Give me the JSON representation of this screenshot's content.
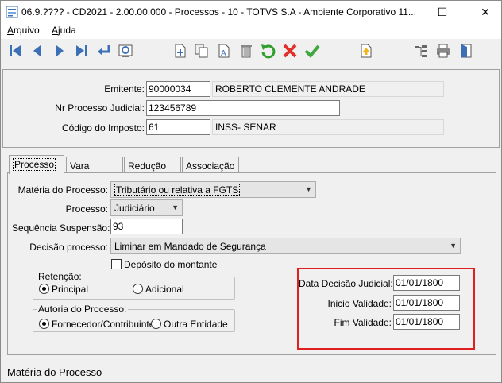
{
  "window": {
    "title": "06.9.???? - CD2021 - 2.00.00.000 - Processos - 10 - TOTVS S.A - Ambiente Corporativo 11...",
    "minimize": "—",
    "maximize": "☐",
    "close": "✕"
  },
  "menu": {
    "arquivo_first": "A",
    "arquivo_rest": "rquivo",
    "ajuda_first": "A",
    "ajuda_rest": "juda"
  },
  "toolbar": {
    "icons": [
      "first-record-icon",
      "previous-record-icon",
      "next-record-icon",
      "last-record-icon",
      "return-icon",
      "search-record-icon",
      "new-record-icon",
      "copy-record-icon",
      "edit-record-icon",
      "delete-record-icon",
      "undo-icon",
      "cancel-icon",
      "confirm-icon",
      "export-icon",
      "tree-icon",
      "print-icon",
      "exit-icon"
    ]
  },
  "header": {
    "emitente_label": "Emitente:",
    "emitente_code": "90000034",
    "emitente_name": "ROBERTO CLEMENTE ANDRADE",
    "processo_label": "Nr Processo Judicial:",
    "processo_value": "123456789",
    "imposto_label": "Código do Imposto:",
    "imposto_code": "61",
    "imposto_name": "INSS- SENAR"
  },
  "tabs": [
    "Processo",
    "Vara",
    "Redução",
    "Associação"
  ],
  "form": {
    "materia_label": "Matéria do Processo:",
    "materia_value": "Tributário ou relativa a FGTS",
    "processo_label": "Processo:",
    "processo_value": "Judiciário",
    "sequencia_label": "Sequência Suspensão:",
    "sequencia_value": "93",
    "decisao_label": "Decisão processo:",
    "decisao_value": "Liminar em Mandado de Segurança",
    "deposito_label": "Depósito do montante",
    "deposito_checked": false,
    "retencao_title": "Retenção:",
    "retencao_options": [
      "Principal",
      "Adicional"
    ],
    "retencao_selected": "Principal",
    "autoria_title": "Autoria do Processo:",
    "autoria_options": [
      "Fornecedor/Contribuinte",
      "Outra Entidade"
    ],
    "autoria_selected": "Fornecedor/Contribuinte",
    "data_decisao_label": "Data Decisão Judicial:",
    "data_decisao_value": "01/01/1800",
    "inicio_label": "Inicio Validade:",
    "inicio_value": "01/01/1800",
    "fim_label": "Fim Validade:",
    "fim_value": "01/01/1800",
    "highlight_color": "#e0201f"
  },
  "status": {
    "text": "Matéria do Processo"
  }
}
